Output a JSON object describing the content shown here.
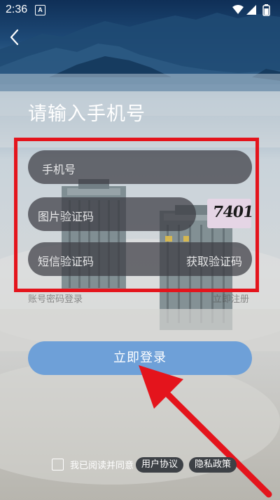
{
  "status_bar": {
    "time": "2:36",
    "notification_icon": "A"
  },
  "header": {
    "back_icon": "chevron-left-icon",
    "title": "请输入手机号"
  },
  "form": {
    "phone_placeholder": "手机号",
    "image_code_placeholder": "图片验证码",
    "captcha_text": "7401",
    "sms_code_placeholder": "短信验证码",
    "get_code_label": "获取验证码",
    "password_login_link": "账号密码登录",
    "register_link": "立即注册"
  },
  "login_button": "立即登录",
  "agreement": {
    "text": "我已阅读并同意",
    "user_agreement": "用户协议",
    "privacy_policy": "隐私政策"
  },
  "colors": {
    "highlight_red": "#e4141c",
    "login_button": "#6ea0d8",
    "field_bg": "rgba(60,60,66,0.72)"
  }
}
